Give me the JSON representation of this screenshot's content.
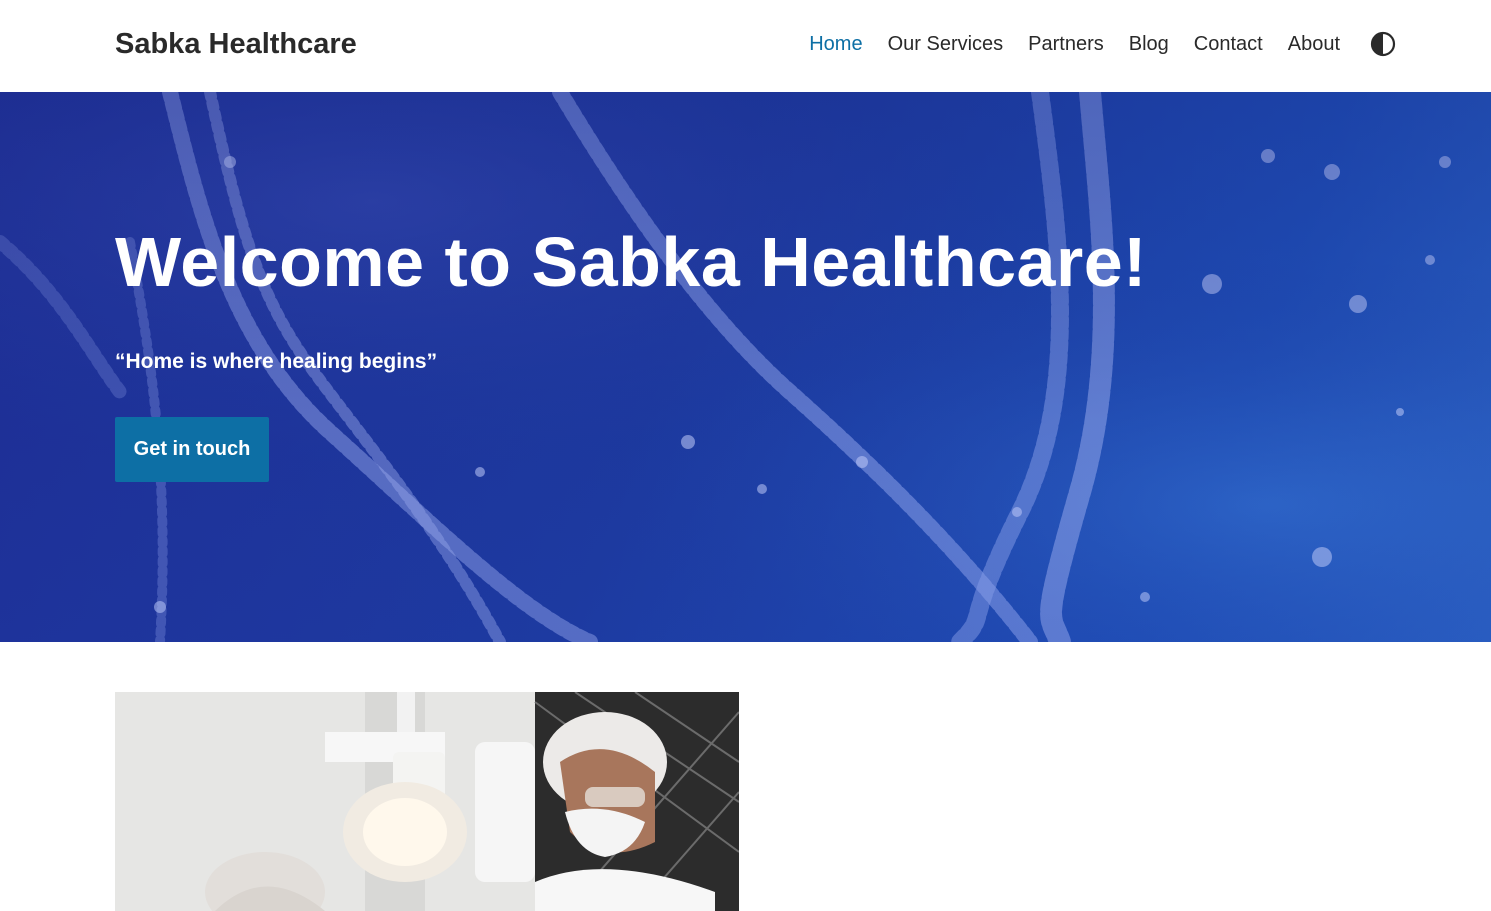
{
  "header": {
    "brand": "Sabka Healthcare",
    "nav": [
      {
        "label": "Home",
        "active": true
      },
      {
        "label": "Our Services",
        "active": false
      },
      {
        "label": "Partners",
        "active": false
      },
      {
        "label": "Blog",
        "active": false
      },
      {
        "label": "Contact",
        "active": false
      },
      {
        "label": "About",
        "active": false
      }
    ],
    "theme_toggle_icon": "contrast-icon"
  },
  "hero": {
    "title": "Welcome to Sabka Healthcare!",
    "quote": "“Home is where healing begins”",
    "cta_label": "Get in touch",
    "background_icon": "dna-strand-image"
  },
  "content": {
    "image_icon": "medical-staff-photo"
  },
  "colors": {
    "accent": "#0d6fa5",
    "hero_blue": "#1d3aa0",
    "text": "#2a2a2a"
  }
}
